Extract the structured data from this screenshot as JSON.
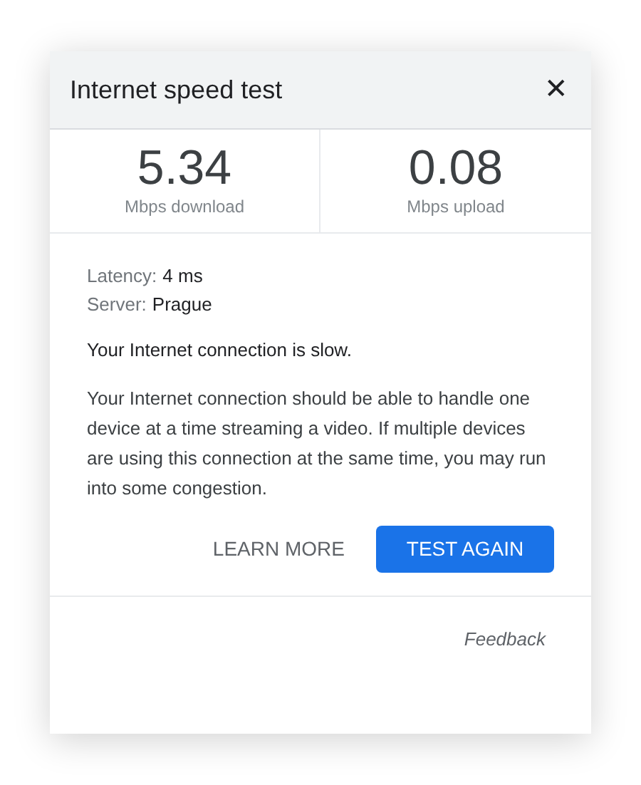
{
  "dialog": {
    "title": "Internet speed test",
    "close": "✕"
  },
  "results": [
    {
      "value": "5.34",
      "unit": "Mbps download"
    },
    {
      "value": "0.08",
      "unit": "Mbps upload"
    }
  ],
  "details": [
    {
      "label": "Latency:",
      "value": "4 ms"
    },
    {
      "label": "Server:",
      "value": "Prague"
    }
  ],
  "summary": "Your Internet connection is slow.",
  "explanation": "Your Internet connection should be able to handle one device at a time streaming a video. If multiple devices are using this connection at the same time, you may run into some congestion.",
  "buttons": [
    {
      "kind": "text",
      "label": "LEARN MORE"
    },
    {
      "kind": "primary",
      "label": "TEST AGAIN"
    }
  ],
  "feedback": "Feedback"
}
